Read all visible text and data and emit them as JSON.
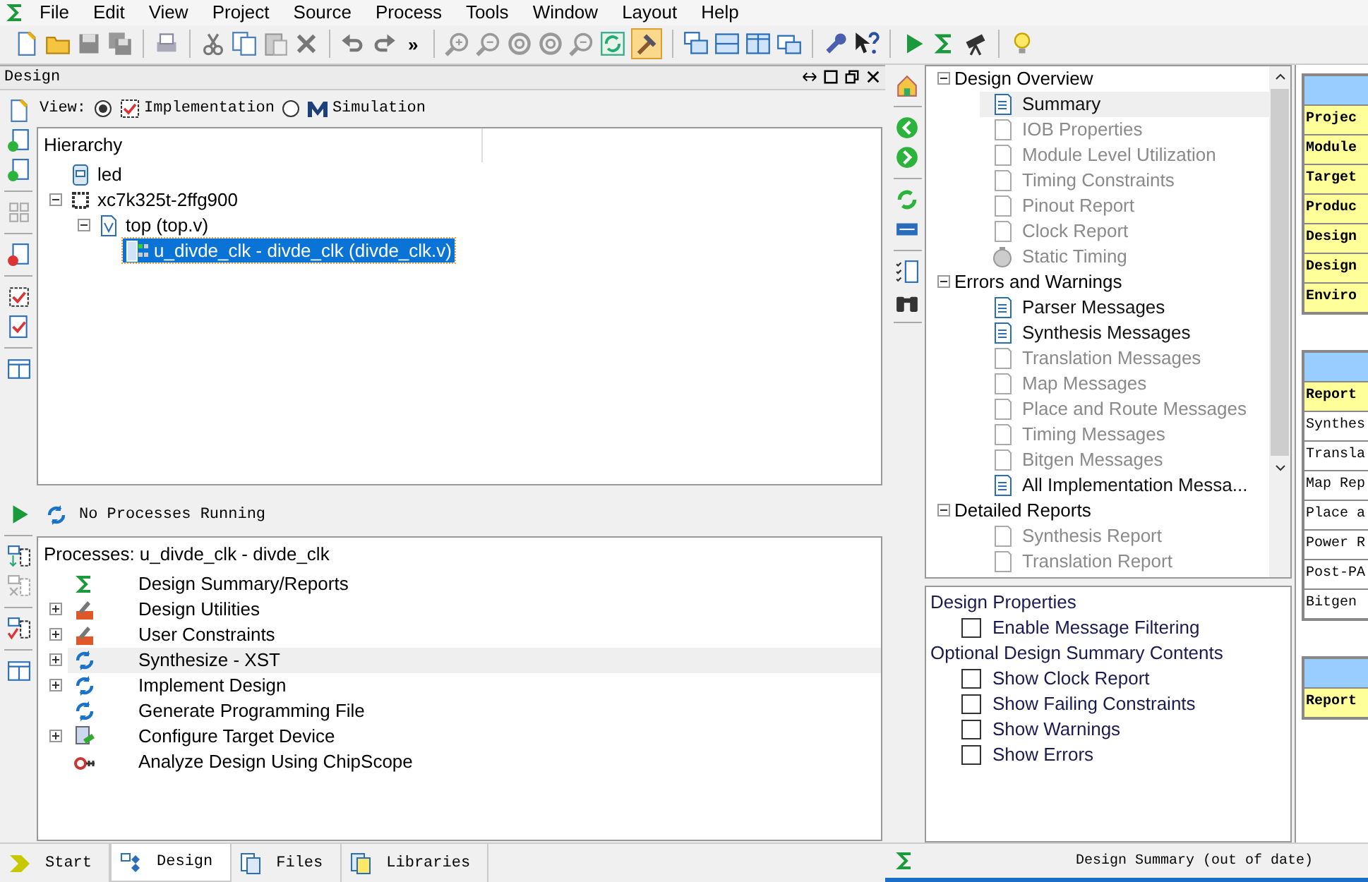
{
  "menu": [
    "File",
    "Edit",
    "View",
    "Project",
    "Source",
    "Process",
    "Tools",
    "Window",
    "Layout",
    "Help"
  ],
  "toolbar": {
    "overflow": "»",
    "hammer_toggle_selected": true
  },
  "design_panel": {
    "title": "Design",
    "view_label": "View:",
    "view_options": [
      {
        "label": "Implementation",
        "selected": true
      },
      {
        "label": "Simulation",
        "selected": false
      }
    ],
    "hierarchy_header": "Hierarchy",
    "hierarchy": [
      {
        "label": "led",
        "kind": "project",
        "selected": false
      },
      {
        "label": "xc7k325t-2ffg900",
        "kind": "chip",
        "selected": false,
        "expanded": true,
        "children": [
          {
            "label": "top (top.v)",
            "kind": "verilog",
            "selected": false,
            "expanded": true,
            "children": [
              {
                "label": "u_divde_clk - divde_clk (divde_clk.v)",
                "kind": "module",
                "selected": true
              }
            ]
          }
        ]
      }
    ]
  },
  "process_panel": {
    "status": "No Processes Running",
    "header": "Processes: u_divde_clk - divde_clk",
    "processes": [
      {
        "label": "Design Summary/Reports",
        "kind": "summary",
        "selected": false
      },
      {
        "label": "Design Utilities",
        "kind": "tools",
        "selected": false,
        "expanded": false
      },
      {
        "label": "User Constraints",
        "kind": "tools",
        "selected": false,
        "expanded": false
      },
      {
        "label": "Synthesize - XST",
        "kind": "run",
        "selected": true,
        "expanded": false
      },
      {
        "label": "Implement Design",
        "kind": "run",
        "selected": false,
        "expanded": false
      },
      {
        "label": "Generate Programming File",
        "kind": "run",
        "selected": false
      },
      {
        "label": "Configure Target Device",
        "kind": "configure",
        "selected": false,
        "expanded": false
      },
      {
        "label": "Analyze Design Using ChipScope",
        "kind": "chipscope",
        "selected": false
      }
    ]
  },
  "bottom_tabs": [
    {
      "label": "Start",
      "kind": "start",
      "selected": false
    },
    {
      "label": "Design",
      "kind": "design",
      "selected": true
    },
    {
      "label": "Files",
      "kind": "files",
      "selected": false
    },
    {
      "label": "Libraries",
      "kind": "libraries",
      "selected": false
    }
  ],
  "summary_tree": [
    {
      "label": "Design Overview",
      "kind": "group",
      "selected": false,
      "expanded": true,
      "children": [
        {
          "label": "Summary",
          "kind": "report",
          "available": true,
          "selected": true
        },
        {
          "label": "IOB Properties",
          "kind": "report",
          "available": false,
          "selected": false
        },
        {
          "label": "Module Level Utilization",
          "kind": "report",
          "available": false,
          "selected": false
        },
        {
          "label": "Timing Constraints",
          "kind": "report",
          "available": false,
          "selected": false
        },
        {
          "label": "Pinout Report",
          "kind": "report",
          "available": false,
          "selected": false
        },
        {
          "label": "Clock Report",
          "kind": "report",
          "available": false,
          "selected": false
        },
        {
          "label": "Static Timing",
          "kind": "timing",
          "available": false,
          "selected": false
        }
      ]
    },
    {
      "label": "Errors and Warnings",
      "kind": "group",
      "selected": false,
      "expanded": true,
      "children": [
        {
          "label": "Parser Messages",
          "kind": "report",
          "available": true,
          "selected": false
        },
        {
          "label": "Synthesis Messages",
          "kind": "report",
          "available": true,
          "selected": false
        },
        {
          "label": "Translation Messages",
          "kind": "report",
          "available": false,
          "selected": false
        },
        {
          "label": "Map Messages",
          "kind": "report",
          "available": false,
          "selected": false
        },
        {
          "label": "Place and Route Messages",
          "kind": "report",
          "available": false,
          "selected": false
        },
        {
          "label": "Timing Messages",
          "kind": "report",
          "available": false,
          "selected": false
        },
        {
          "label": "Bitgen Messages",
          "kind": "report",
          "available": false,
          "selected": false
        },
        {
          "label": "All Implementation Messa...",
          "kind": "report",
          "available": true,
          "selected": false
        }
      ]
    },
    {
      "label": "Detailed Reports",
      "kind": "group",
      "selected": false,
      "expanded": true,
      "children": [
        {
          "label": "Synthesis Report",
          "kind": "report",
          "available": false,
          "selected": false
        },
        {
          "label": "Translation Report",
          "kind": "report",
          "available": false,
          "selected": false
        }
      ]
    }
  ],
  "properties": [
    {
      "label": "Design Properties",
      "options": [
        {
          "label": "Enable Message Filtering",
          "checked": false
        }
      ]
    },
    {
      "label": "Optional Design Summary Contents",
      "options": [
        {
          "label": "Show Clock Report",
          "checked": false
        },
        {
          "label": "Show Failing Constraints",
          "checked": false
        },
        {
          "label": "Show Warnings",
          "checked": false
        },
        {
          "label": "Show Errors",
          "checked": false
        }
      ]
    }
  ],
  "report_tables": [
    {
      "rows": [
        {
          "text": "Projec",
          "kind": "label"
        },
        {
          "text": "Module",
          "kind": "label"
        },
        {
          "text": "Target",
          "kind": "label"
        },
        {
          "text": "Produc",
          "kind": "label"
        },
        {
          "text": "Design",
          "kind": "label"
        },
        {
          "text": "Design",
          "kind": "label"
        },
        {
          "text": "Enviro",
          "kind": "label"
        }
      ]
    },
    {
      "rows": [
        {
          "text": "Report",
          "kind": "label"
        },
        {
          "text": "Synthes",
          "kind": "link"
        },
        {
          "text": "Transla",
          "kind": "link"
        },
        {
          "text": "Map Rep",
          "kind": "link"
        },
        {
          "text": "Place a",
          "kind": "link"
        },
        {
          "text": "Power R",
          "kind": "link"
        },
        {
          "text": "Post-PA",
          "kind": "link"
        },
        {
          "text": "Bitgen",
          "kind": "link"
        }
      ]
    },
    {
      "rows": [
        {
          "text": "Report",
          "kind": "label"
        }
      ]
    }
  ],
  "summary_tab": "Design Summary (out of date)"
}
